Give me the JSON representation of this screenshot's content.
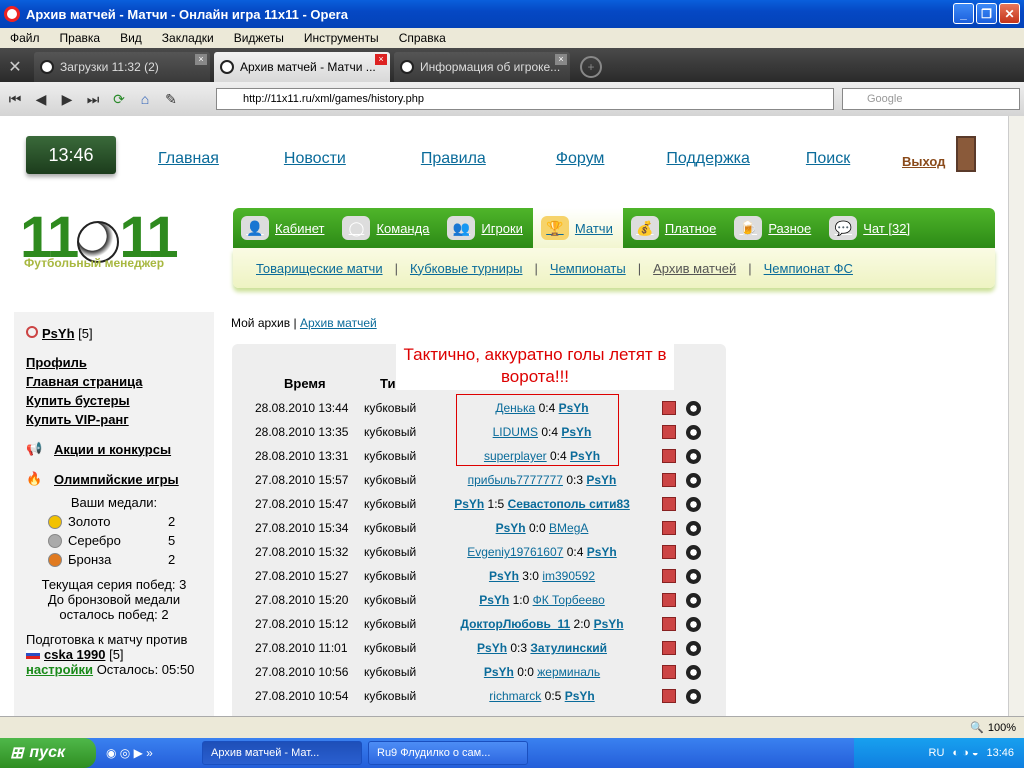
{
  "window": {
    "title": "Архив матчей - Матчи - Онлайн игра 11x11 - Opera"
  },
  "menu": [
    "Файл",
    "Правка",
    "Вид",
    "Закладки",
    "Виджеты",
    "Инструменты",
    "Справка"
  ],
  "tabs": [
    {
      "label": "Загрузки 11:32 (2)"
    },
    {
      "label": "Архив матчей - Матчи ..."
    },
    {
      "label": "Информация об игроке..."
    }
  ],
  "address": {
    "url": "http://11x11.ru/xml/games/history.php",
    "search_placeholder": "Google"
  },
  "site": {
    "clock": "13:46",
    "topnav": [
      "Главная",
      "Новости",
      "Правила",
      "Форум",
      "Поддержка",
      "Поиск"
    ],
    "logout": "Выход",
    "logo": "11",
    "logo2": "11",
    "logo_sub": "Футбольный менеджер",
    "mainnav": [
      "Кабинет",
      "Команда",
      "Игроки",
      "Матчи",
      "Платное",
      "Разное",
      "Чат [32]"
    ],
    "subnav": [
      "Товарищеские матчи",
      "Кубковые турниры",
      "Чемпионаты",
      "Архив матчей",
      "Чемпионат ФС"
    ]
  },
  "sidebar": {
    "user": "PsYh",
    "level": "[5]",
    "links": [
      "Профиль",
      "Главная страница",
      "Купить бустеры",
      "Купить VIP-ранг"
    ],
    "promo": "Акции и конкурсы",
    "olympic": "Олимпийские игры",
    "medals_title": "Ваши медали:",
    "medals": [
      {
        "name": "Золото",
        "count": "2",
        "color": "#f2c200"
      },
      {
        "name": "Серебро",
        "count": "5",
        "color": "#aaaaaa"
      },
      {
        "name": "Бронза",
        "count": "2",
        "color": "#e07a20"
      }
    ],
    "streak1": "Текущая серия побед: 3",
    "streak2": "До бронзовой медали",
    "streak3": "осталось побед: 2",
    "prep": "Подготовка к матчу против",
    "opponent": "cska 1990",
    "opp_level": "[5]",
    "settings": "настройки",
    "left": "Осталось: 05:50"
  },
  "crumb": {
    "current": "Мой архив",
    "sep": "|",
    "link": "Архив матчей"
  },
  "annotation": "Тактично, аккуратно голы летят в ворота!!!",
  "table": {
    "headers": {
      "time": "Время",
      "type": "Тип"
    },
    "rows": [
      {
        "date": "28.08.2010 13:44",
        "type": "кубковый",
        "a": "Денька",
        "score": "0:4",
        "b": "PsYh"
      },
      {
        "date": "28.08.2010 13:35",
        "type": "кубковый",
        "a": "LIDUMS",
        "score": "0:4",
        "b": "PsYh"
      },
      {
        "date": "28.08.2010 13:31",
        "type": "кубковый",
        "a": "superplayer",
        "score": "0:4",
        "b": "PsYh"
      },
      {
        "date": "27.08.2010 15:57",
        "type": "кубковый",
        "a": "прибыль7777777",
        "score": "0:3",
        "b": "PsYh"
      },
      {
        "date": "27.08.2010 15:47",
        "type": "кубковый",
        "a": "PsYh",
        "score": "1:5",
        "b": "Севастополь сити83"
      },
      {
        "date": "27.08.2010 15:34",
        "type": "кубковый",
        "a": "PsYh",
        "score": "0:0",
        "b": "BMegA"
      },
      {
        "date": "27.08.2010 15:32",
        "type": "кубковый",
        "a": "Evgeniy19761607",
        "score": "0:4",
        "b": "PsYh"
      },
      {
        "date": "27.08.2010 15:27",
        "type": "кубковый",
        "a": "PsYh",
        "score": "3:0",
        "b": "im390592"
      },
      {
        "date": "27.08.2010 15:20",
        "type": "кубковый",
        "a": "PsYh",
        "score": "1:0",
        "b": "ФК Торбеево"
      },
      {
        "date": "27.08.2010 15:12",
        "type": "кубковый",
        "a": "ДокторЛюбовь_11",
        "score": "2:0",
        "b": "PsYh"
      },
      {
        "date": "27.08.2010 11:01",
        "type": "кубковый",
        "a": "PsYh",
        "score": "0:3",
        "b": "Затулинский"
      },
      {
        "date": "27.08.2010 10:56",
        "type": "кубковый",
        "a": "PsYh",
        "score": "0:0",
        "b": "жерминаль"
      },
      {
        "date": "27.08.2010 10:54",
        "type": "кубковый",
        "a": "richmarck",
        "score": "0:5",
        "b": "PsYh"
      }
    ]
  },
  "statusbar": {
    "zoom": "100%"
  },
  "taskbar": {
    "start": "пуск",
    "tasks": [
      "Архив матчей - Мат...",
      "Ru9 Флудилко о сам..."
    ],
    "lang": "RU",
    "time": "13:46"
  }
}
